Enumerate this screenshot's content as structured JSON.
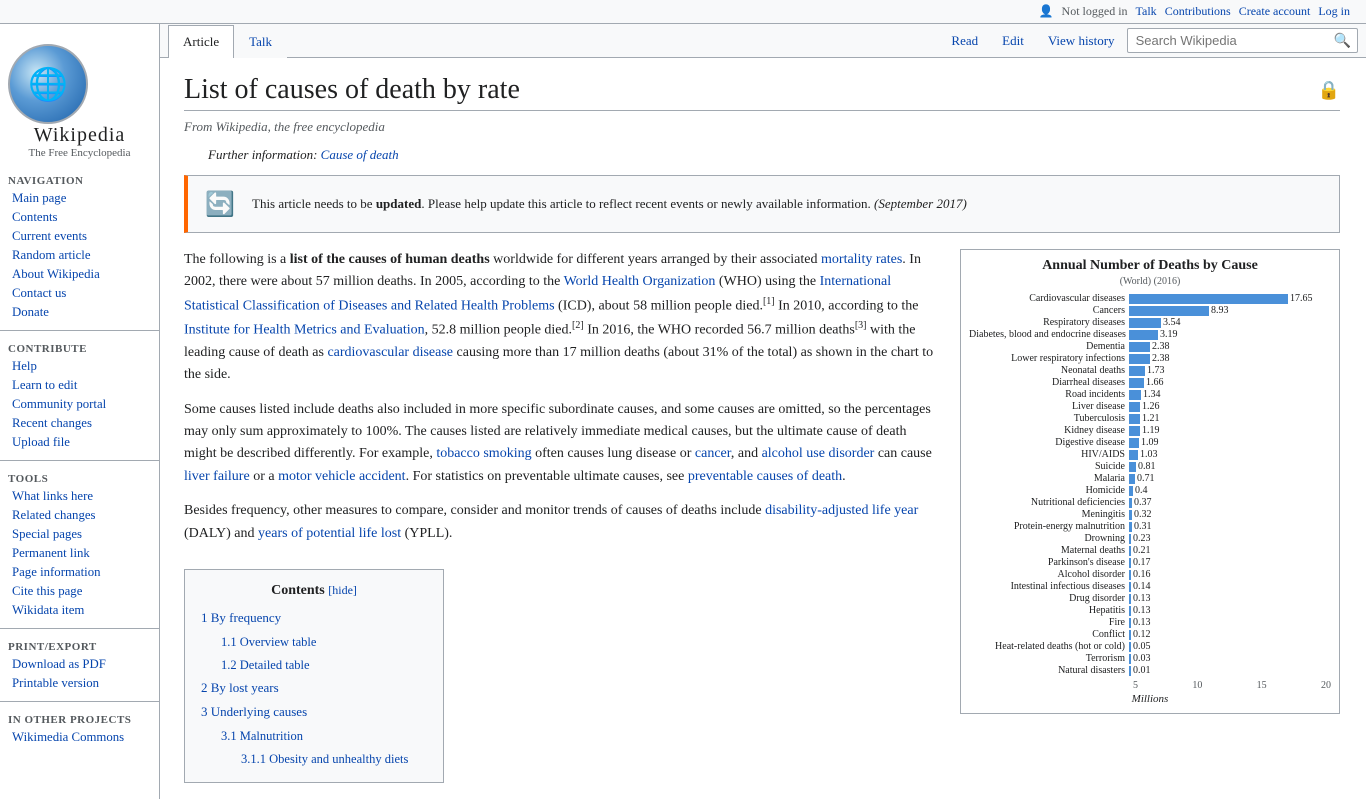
{
  "topbar": {
    "user_icon": "👤",
    "not_logged_in": "Not logged in",
    "talk": "Talk",
    "contributions": "Contributions",
    "create_account": "Create account",
    "log_in": "Log in"
  },
  "sidebar": {
    "logo_title": "Wikipedia",
    "logo_subtitle": "The Free Encyclopedia",
    "navigation_header": "Navigation",
    "nav_items": [
      {
        "label": "Main page",
        "id": "main-page"
      },
      {
        "label": "Contents",
        "id": "contents"
      },
      {
        "label": "Current events",
        "id": "current-events"
      },
      {
        "label": "Random article",
        "id": "random-article"
      },
      {
        "label": "About Wikipedia",
        "id": "about-wikipedia"
      },
      {
        "label": "Contact us",
        "id": "contact-us"
      },
      {
        "label": "Donate",
        "id": "donate"
      }
    ],
    "contribute_header": "Contribute",
    "contribute_items": [
      {
        "label": "Help",
        "id": "help"
      },
      {
        "label": "Learn to edit",
        "id": "learn-to-edit"
      },
      {
        "label": "Community portal",
        "id": "community-portal"
      },
      {
        "label": "Recent changes",
        "id": "recent-changes"
      },
      {
        "label": "Upload file",
        "id": "upload-file"
      }
    ],
    "tools_header": "Tools",
    "tools_items": [
      {
        "label": "What links here",
        "id": "what-links-here"
      },
      {
        "label": "Related changes",
        "id": "related-changes"
      },
      {
        "label": "Special pages",
        "id": "special-pages"
      },
      {
        "label": "Permanent link",
        "id": "permanent-link"
      },
      {
        "label": "Page information",
        "id": "page-information"
      },
      {
        "label": "Cite this page",
        "id": "cite-this-page"
      },
      {
        "label": "Wikidata item",
        "id": "wikidata-item"
      }
    ],
    "print_header": "Print/export",
    "print_items": [
      {
        "label": "Download as PDF",
        "id": "download-pdf"
      },
      {
        "label": "Printable version",
        "id": "printable-version"
      }
    ],
    "other_header": "In other projects",
    "other_items": [
      {
        "label": "Wikimedia Commons",
        "id": "wikimedia-commons"
      }
    ]
  },
  "tabs": {
    "article": "Article",
    "talk": "Talk",
    "read": "Read",
    "edit": "Edit",
    "view_history": "View history"
  },
  "search": {
    "placeholder": "Search Wikipedia"
  },
  "article": {
    "title": "List of causes of death by rate",
    "from_text": "From Wikipedia, the free encyclopedia",
    "further_info_prefix": "Further information:",
    "further_info_link": "Cause of death",
    "notice_text": "This article needs to be",
    "notice_bold": "updated",
    "notice_rest": ". Please help update this article to reflect recent events or newly available information.",
    "notice_date": "(September 2017)",
    "body_p1": "The following is a",
    "body_p1_bold": "list of the causes of human deaths",
    "body_p1_rest": "worldwide for different years arranged by their associated",
    "mortality_rates_link": "mortality rates",
    "body_p1_cont": ". In 2002, there were about 57 million deaths. In 2005, according to the",
    "who_link": "World Health Organization",
    "body_p1_cont2": "(WHO) using the",
    "icd_link": "International Statistical Classification of Diseases and Related Health Problems",
    "body_p1_cont3": "(ICD), about 58 million people died.",
    "ref1": "[1]",
    "body_p1_cont4": "In 2010, according to the",
    "ihme_link": "Institute for Health Metrics and Evaluation",
    "body_p1_cont5": ", 52.8 million people died.",
    "ref2": "[2]",
    "body_p1_cont6": "In 2016, the WHO recorded 56.7 million deaths",
    "ref3": "[3]",
    "body_p1_cont7": "with the leading cause of death as",
    "cardio_link": "cardiovascular disease",
    "body_p1_end": "causing more than 17 million deaths (about 31% of the total) as shown in the chart to the side.",
    "body_p2": "Some causes listed include deaths also included in more specific subordinate causes, and some causes are omitted, so the percentages may only sum approximately to 100%. The causes listed are relatively immediate medical causes, but the ultimate cause of death might be described differently. For example,",
    "tobacco_link": "tobacco smoking",
    "body_p2_cont": "often causes lung disease or",
    "cancer_link": "cancer",
    "body_p2_cont2": ", and",
    "alcohol_link": "alcohol use disorder",
    "body_p2_cont3": "can cause",
    "liver_link": "liver failure",
    "body_p2_cont4": "or a",
    "motor_link": "motor vehicle accident",
    "body_p2_end": ". For statistics on preventable ultimate causes, see",
    "preventable_link": "preventable causes of death",
    "body_p2_end2": ".",
    "body_p3_start": "Besides frequency, other measures to compare, consider and monitor trends of causes of deaths include",
    "daly_link": "disability-adjusted life year",
    "body_p3_cont": "(DALY) and",
    "ypll_link": "years of potential life lost",
    "body_p3_end": "(YPLL).",
    "chart": {
      "title": "Annual Number of Deaths by Cause",
      "subtitle": "(World) (2016)",
      "x_labels": [
        "5",
        "10",
        "15",
        "20"
      ],
      "x_axis_label": "Millions",
      "max_val": 20,
      "rows": [
        {
          "label": "Cardiovascular diseases",
          "val": 17.65
        },
        {
          "label": "Cancers",
          "val": 8.93
        },
        {
          "label": "Respiratory diseases",
          "val": 3.54
        },
        {
          "label": "Diabetes, blood and endocrine diseases",
          "val": 3.19
        },
        {
          "label": "Dementia",
          "val": 2.38
        },
        {
          "label": "Lower respiratory infections",
          "val": 2.38
        },
        {
          "label": "Neonatal deaths",
          "val": 1.73
        },
        {
          "label": "Diarrheal diseases",
          "val": 1.66
        },
        {
          "label": "Road incidents",
          "val": 1.34
        },
        {
          "label": "Liver disease",
          "val": 1.26
        },
        {
          "label": "Tuberculosis",
          "val": 1.21
        },
        {
          "label": "Kidney disease",
          "val": 1.19
        },
        {
          "label": "Digestive disease",
          "val": 1.09
        },
        {
          "label": "HIV/AIDS",
          "val": 1.03
        },
        {
          "label": "Suicide",
          "val": 0.81
        },
        {
          "label": "Malaria",
          "val": 0.71
        },
        {
          "label": "Homicide",
          "val": 0.4
        },
        {
          "label": "Nutritional deficiencies",
          "val": 0.37
        },
        {
          "label": "Meningitis",
          "val": 0.32
        },
        {
          "label": "Protein-energy malnutrition",
          "val": 0.31
        },
        {
          "label": "Drowning",
          "val": 0.23
        },
        {
          "label": "Maternal deaths",
          "val": 0.21
        },
        {
          "label": "Parkinson's disease",
          "val": 0.17
        },
        {
          "label": "Alcohol disorder",
          "val": 0.16
        },
        {
          "label": "Intestinal infectious diseases",
          "val": 0.14
        },
        {
          "label": "Drug disorder",
          "val": 0.13
        },
        {
          "label": "Hepatitis",
          "val": 0.13
        },
        {
          "label": "Fire",
          "val": 0.13
        },
        {
          "label": "Conflict",
          "val": 0.12
        },
        {
          "label": "Heat-related deaths (hot or cold)",
          "val": 0.05
        },
        {
          "label": "Terrorism",
          "val": 0.03
        },
        {
          "label": "Natural disasters",
          "val": 0.01
        }
      ]
    },
    "contents": {
      "title": "Contents",
      "toggle": "[hide]",
      "items": [
        {
          "num": "1",
          "label": "By frequency",
          "level": 1,
          "id": "by-frequency"
        },
        {
          "num": "1.1",
          "label": "Overview table",
          "level": 2,
          "id": "overview-table"
        },
        {
          "num": "1.2",
          "label": "Detailed table",
          "level": 2,
          "id": "detailed-table"
        },
        {
          "num": "2",
          "label": "By lost years",
          "level": 1,
          "id": "by-lost-years"
        },
        {
          "num": "3",
          "label": "Underlying causes",
          "level": 1,
          "id": "underlying-causes"
        },
        {
          "num": "3.1",
          "label": "Malnutrition",
          "level": 2,
          "id": "malnutrition"
        },
        {
          "num": "3.1.1",
          "label": "Obesity and unhealthy diets",
          "level": 3,
          "id": "obesity"
        }
      ]
    }
  }
}
